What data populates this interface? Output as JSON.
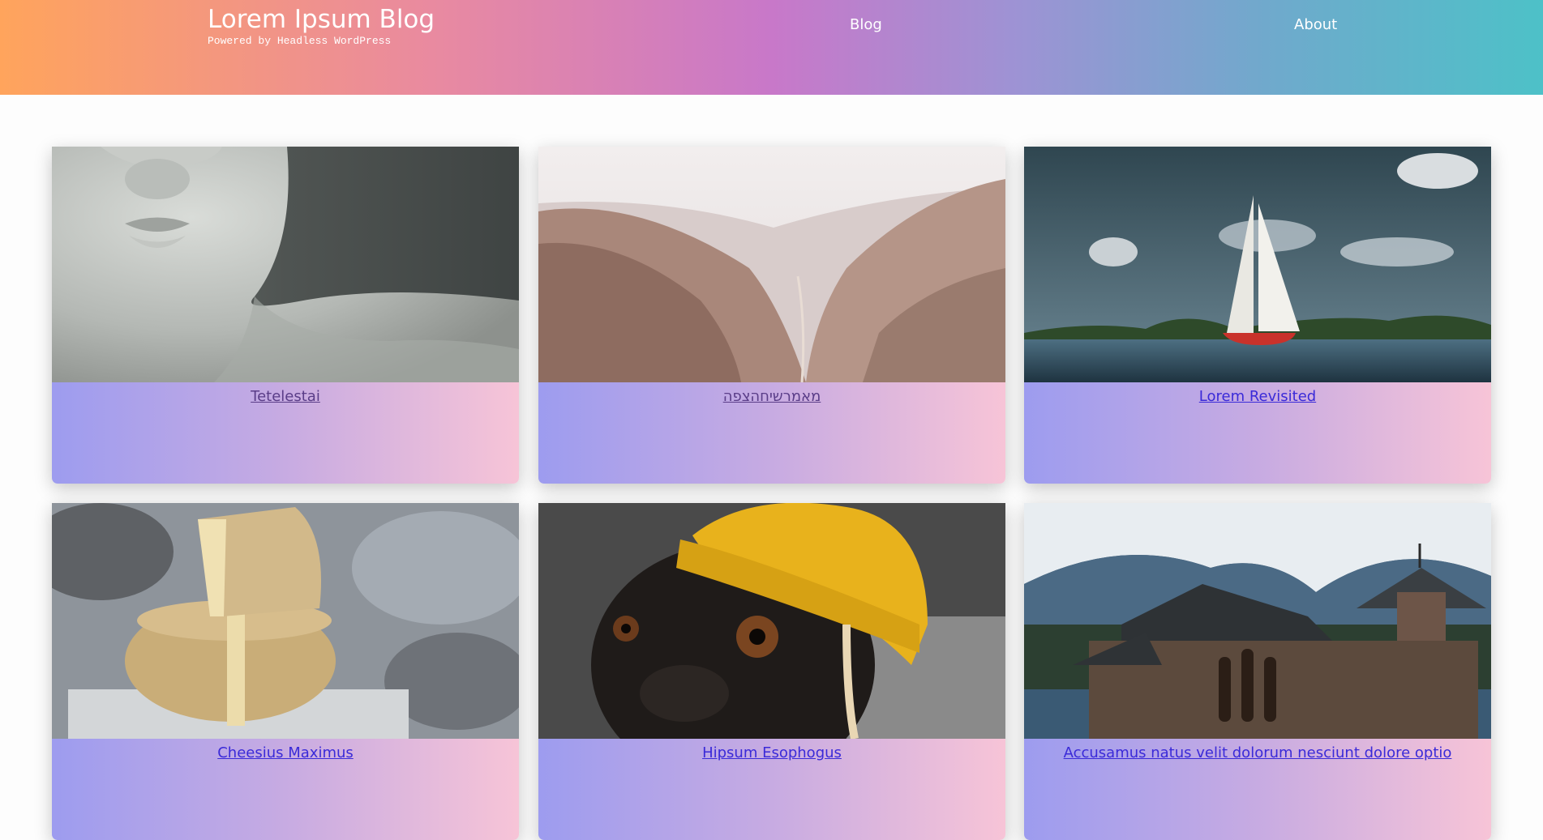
{
  "site": {
    "title": "Lorem Ipsum Blog",
    "tagline": "Powered by Headless WordPress"
  },
  "nav": [
    {
      "label": "Blog"
    },
    {
      "label": "About"
    }
  ],
  "posts": [
    {
      "title": "Tetelestai",
      "image": "marble-statue-image",
      "visited": true
    },
    {
      "title": "מאמרשיחהצפה",
      "image": "desert-valley-image",
      "visited": true
    },
    {
      "title": "Lorem Revisited",
      "image": "sailboat-lake-image",
      "visited": false
    },
    {
      "title": "Cheesius Maximus",
      "image": "cheese-wheels-image",
      "visited": false
    },
    {
      "title": "Hipsum Esophogus",
      "image": "pug-yellow-beanie-image",
      "visited": false
    },
    {
      "title": "Accusamus natus velit dolorum nesciunt dolore optio",
      "image": "stone-chapel-mountains-image",
      "visited": false
    }
  ],
  "colors": {
    "header_gradient": [
      "#ffa45c",
      "#c878c9",
      "#4dc1c8"
    ],
    "card_gradient": [
      "#9d9cef",
      "#f7c4d7"
    ],
    "link": "#3a2ad8",
    "link_visited": "#5a3d88"
  }
}
